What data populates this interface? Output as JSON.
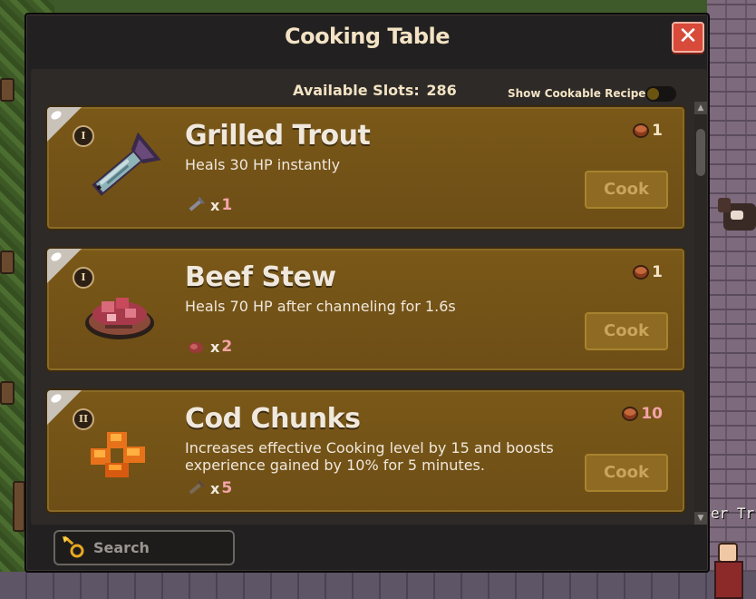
{
  "window": {
    "title": "Cooking Table",
    "close_symbol": "✕"
  },
  "toolbar": {
    "available_slots_label": "Available Slots:",
    "available_slots_value": "286",
    "show_cookable_label": "Show Cookable Recipes",
    "show_cookable_enabled": false
  },
  "recipes": [
    {
      "tier": "I",
      "name": "Grilled Trout",
      "description": "Heals 30 HP instantly",
      "ingredient_icon": "raw-trout-icon",
      "ingredient_x": "x",
      "ingredient_qty": "1",
      "cost": "1",
      "cook_label": "Cook"
    },
    {
      "tier": "I",
      "name": "Beef Stew",
      "description": "Heals 70 HP after channeling for 1.6s",
      "ingredient_icon": "raw-beef-icon",
      "ingredient_x": "x",
      "ingredient_qty": "2",
      "cost": "1",
      "cook_label": "Cook"
    },
    {
      "tier": "II",
      "name": "Cod Chunks",
      "description": "Increases effective Cooking level by 15 and boosts experience gained by 10% for 5 minutes.",
      "ingredient_icon": "raw-cod-icon",
      "ingredient_x": "x",
      "ingredient_qty": "5",
      "cost": "10",
      "cook_label": "Cook"
    }
  ],
  "search": {
    "placeholder": "Search"
  },
  "background": {
    "sign_text": "er Tr"
  },
  "colors": {
    "panel": "#222020",
    "card": "#7a5818",
    "close": "#d84a3a",
    "accent_pink": "#f4a4a8"
  }
}
